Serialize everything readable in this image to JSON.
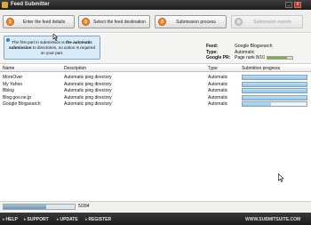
{
  "window": {
    "title": "Feed Submitter",
    "minimize_glyph": "_",
    "close_glyph": "x"
  },
  "toolbar": {
    "steps": [
      {
        "number": "1",
        "label": "Enter the feed details",
        "enabled": true
      },
      {
        "number": "2",
        "label": "Select the feed destination",
        "enabled": true
      },
      {
        "number": "3",
        "label": "Submission process",
        "enabled": true
      },
      {
        "number": "4",
        "label": "Submission reports",
        "enabled": false
      }
    ]
  },
  "tooltip": {
    "text_before": "The first part in submission is ",
    "bold": "the automatic submission",
    "text_after": " to directories, no action is required on your part."
  },
  "feed_info": {
    "feed_label": "Feed:",
    "feed_value": "Google Blogsearch",
    "type_label": "Type:",
    "type_value": "Automatic",
    "pr_label": "Google PR:",
    "pr_value": "Page rank 8/10",
    "pr_fraction": 0.8
  },
  "table": {
    "headers": {
      "name": "Name",
      "description": "Description",
      "type": "Type",
      "progress": "Submition progress"
    },
    "rows": [
      {
        "name": "MoreOver",
        "description": "Automatic ping directory",
        "type": "Automatic",
        "progress": 1.0
      },
      {
        "name": "My Yahoo",
        "description": "Automatic ping directory",
        "type": "Automatic",
        "progress": 1.0
      },
      {
        "name": "Bblog",
        "description": "Automatic ping directory",
        "type": "Automatic",
        "progress": 1.0
      },
      {
        "name": "Blog.goo.ne.jp",
        "description": "Automatic ping directory",
        "type": "Automatic",
        "progress": 1.0
      },
      {
        "name": "Google Blogsearch",
        "description": "Automatic ping directory",
        "type": "Automatic",
        "progress": 0.45
      }
    ]
  },
  "status": {
    "count": "5/284",
    "overall_progress": 0.6
  },
  "footer": {
    "links": [
      "HELP",
      "SUPPORT",
      "UPDATE",
      "REGISTER"
    ],
    "site": "WWW.SUBMITSUITE.COM"
  }
}
